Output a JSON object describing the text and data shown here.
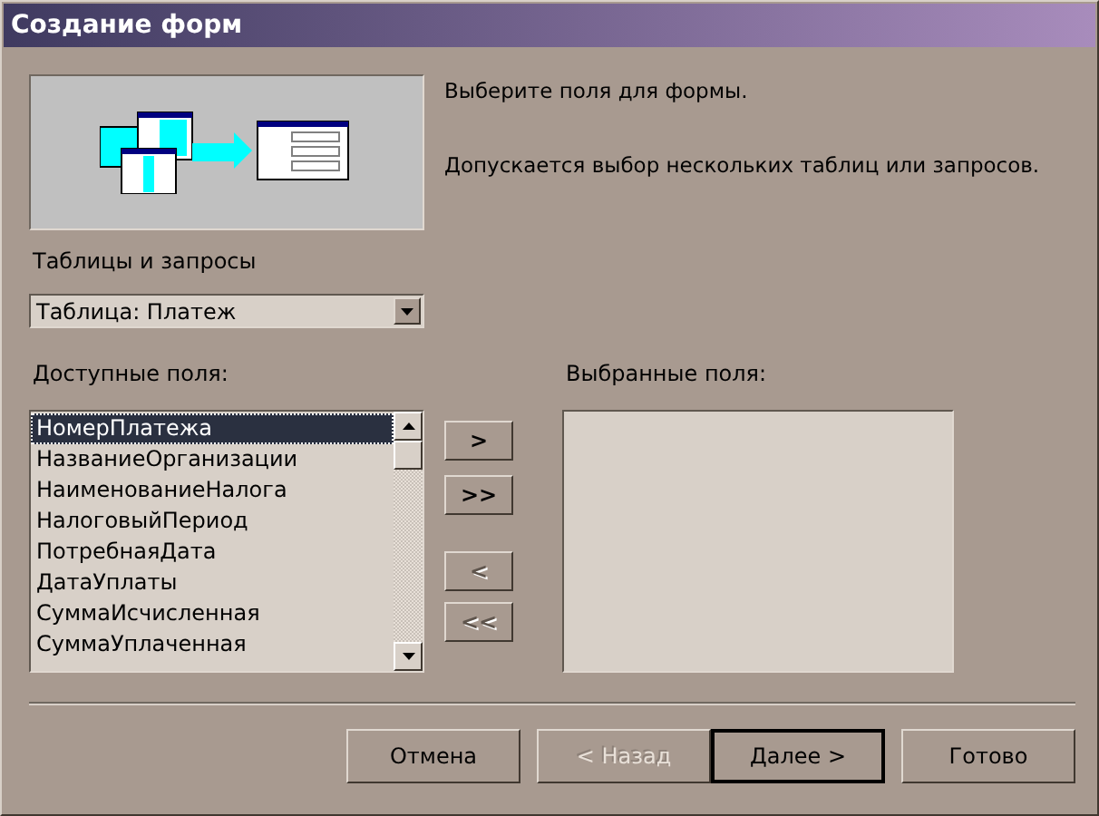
{
  "window": {
    "title": "Создание форм"
  },
  "instructions": [
    "Выберите поля для формы.",
    "Допускается выбор нескольких таблиц или запросов."
  ],
  "source": {
    "label": "Таблицы и запросы",
    "value": "Таблица: Платеж"
  },
  "available": {
    "label": "Доступные поля:",
    "items": [
      {
        "text": "НомерПлатежа",
        "selected": true
      },
      {
        "text": "НазваниеОрганизации",
        "selected": false
      },
      {
        "text": "НаименованиеНалога",
        "selected": false
      },
      {
        "text": "НалоговыйПериод",
        "selected": false
      },
      {
        "text": "ПотребнаяДата",
        "selected": false
      },
      {
        "text": "ДатаУплаты",
        "selected": false
      },
      {
        "text": "СуммаИсчисленная",
        "selected": false
      },
      {
        "text": "СуммаУплаченная",
        "selected": false
      }
    ]
  },
  "move_buttons": [
    {
      "label": ">",
      "disabled": false
    },
    {
      "label": ">>",
      "disabled": false
    },
    {
      "label": "<",
      "disabled": true
    },
    {
      "label": "<<",
      "disabled": true
    }
  ],
  "chosen": {
    "label": "Выбранные поля:"
  },
  "buttons": [
    {
      "label": "Отмена",
      "disabled": false,
      "default": false
    },
    {
      "label": "< Назад",
      "disabled": true,
      "default": false
    },
    {
      "label": "Далее >",
      "disabled": false,
      "default": true
    },
    {
      "label": "Готово",
      "disabled": false,
      "default": false
    }
  ]
}
